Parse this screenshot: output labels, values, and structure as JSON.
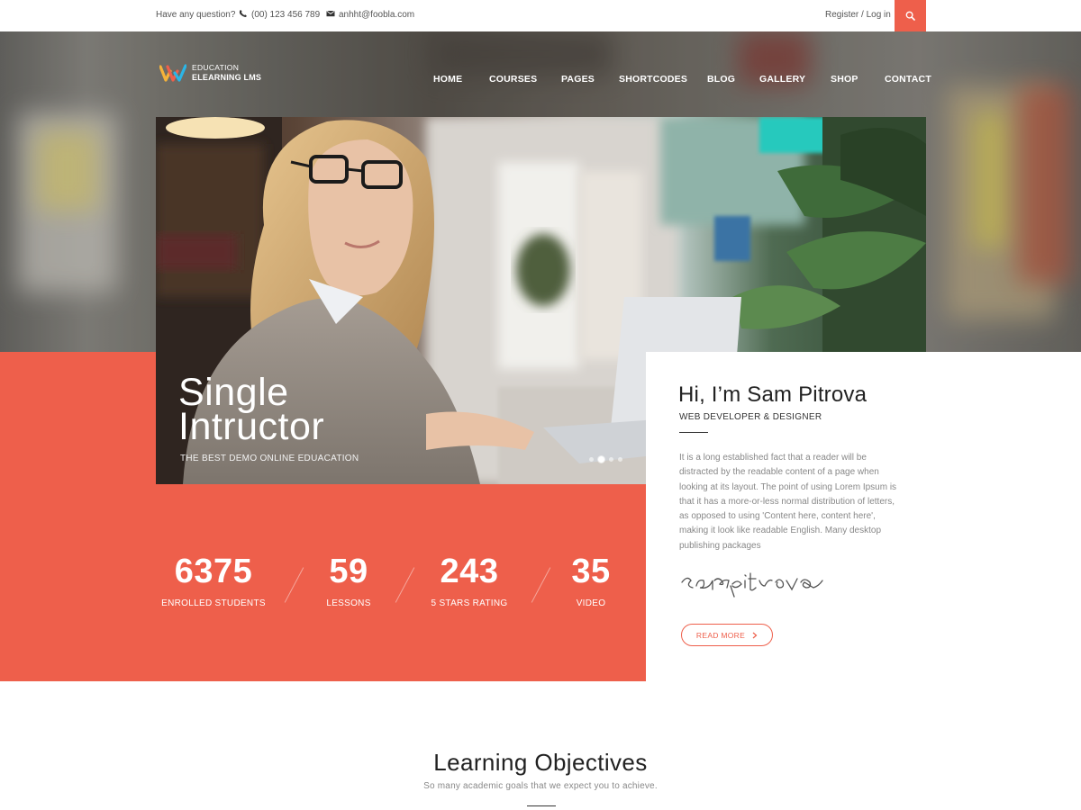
{
  "topbar": {
    "question": "Have any question?",
    "phone": "(00) 123 456 789",
    "email": "anhht@foobla.com",
    "auth": "Register / Log in",
    "icons": {
      "phone": "phone-icon",
      "email": "envelope-icon",
      "search": "search-icon"
    }
  },
  "logo": {
    "line1": "EDUCATION",
    "line2": "ELEARNING LMS",
    "icon": "w-logo-icon"
  },
  "nav": {
    "items": [
      {
        "label": "HOME"
      },
      {
        "label": "COURSES"
      },
      {
        "label": "PAGES"
      },
      {
        "label": "SHORTCODES"
      },
      {
        "label": "BLOG"
      },
      {
        "label": "GALLERY"
      },
      {
        "label": "SHOP"
      },
      {
        "label": "CONTACT"
      }
    ]
  },
  "slider": {
    "title_line1": "Single",
    "title_line2": "Intructor",
    "subtitle": "THE BEST DEMO ONLINE EDUACATION",
    "dots": 4,
    "active_dot": 2
  },
  "card": {
    "name": "Hi, I’m Sam Pitrova",
    "role": "WEB DEVELOPER & DESIGNER",
    "paragraph": "It is a long established fact that a reader will be distracted by the readable content of a page when looking at its layout. The point of using Lorem Ipsum is that it has a more-or-less normal distribution of letters, as opposed to using 'Content here, content here', making it look like readable English. Many desktop publishing packages",
    "signature": "sampitrova",
    "button": "READ MORE"
  },
  "stats": [
    {
      "value": "6375",
      "label": "ENROLLED STUDENTS"
    },
    {
      "value": "59",
      "label": "LESSONS"
    },
    {
      "value": "243",
      "label": "5 STARS RATING"
    },
    {
      "value": "35",
      "label": "VIDEO"
    }
  ],
  "objectives": {
    "title": "Learning Objectives",
    "subtitle": "So many academic goals that we expect you to achieve."
  },
  "colors": {
    "accent": "#ee5f4b",
    "text_dark": "#222222",
    "text_muted": "#888888"
  }
}
